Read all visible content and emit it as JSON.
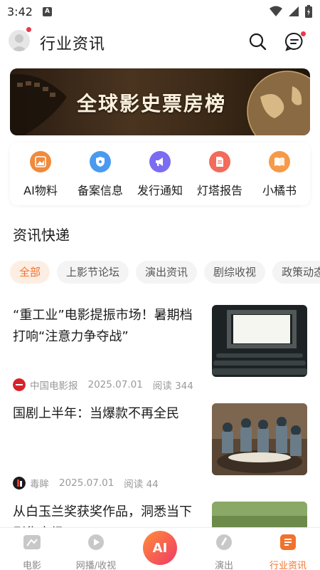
{
  "status_bar": {
    "time": "3:42",
    "notif_letter": "A"
  },
  "header": {
    "title": "行业资讯"
  },
  "banner": {
    "title": "全球影史票房榜"
  },
  "quick_menu": [
    {
      "label": "AI物料",
      "icon": "image-icon",
      "color": "#f08a3c"
    },
    {
      "label": "备案信息",
      "icon": "shield-icon",
      "color": "#4a9bf0"
    },
    {
      "label": "发行通知",
      "icon": "megaphone-icon",
      "color": "#7b6cf2"
    },
    {
      "label": "灯塔报告",
      "icon": "document-icon",
      "color": "#f26b5b"
    },
    {
      "label": "小橘书",
      "icon": "book-icon",
      "color": "#f59a48"
    }
  ],
  "section": {
    "title": "资讯快递"
  },
  "chips": [
    "全部",
    "上影节论坛",
    "演出资讯",
    "剧综收视",
    "政策动态"
  ],
  "news": [
    {
      "title": "“重工业”电影提振市场！暑期档打响“注意力争夺战”",
      "source": "中国电影报",
      "date": "2025.07.01",
      "reads": "阅读 344"
    },
    {
      "title": "国剧上半年：当爆款不再全民",
      "source": "毒眸",
      "date": "2025.07.01",
      "reads": "阅读 44"
    },
    {
      "title": "从白玉兰奖获奖作品，洞悉当下剧集市场",
      "source": "",
      "date": "",
      "reads": ""
    }
  ],
  "bottom_nav": [
    {
      "label": "电影",
      "active": false
    },
    {
      "label": "网播/收视",
      "active": false
    },
    {
      "label": "AI",
      "active": false
    },
    {
      "label": "演出",
      "active": false
    },
    {
      "label": "行业资讯",
      "active": true
    }
  ],
  "colors": {
    "accent": "#f1722d",
    "badge_red": "#e83a4d"
  }
}
